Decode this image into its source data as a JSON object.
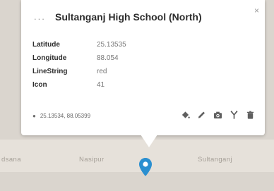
{
  "map": {
    "labels": [
      "dsana",
      "Nasipur",
      "Sultanganj"
    ]
  },
  "popup": {
    "ellipsis": "...",
    "title": "Sultanganj High School (North)",
    "close_label": "×",
    "properties": [
      {
        "key": "Latitude",
        "value": "25.13535"
      },
      {
        "key": "Longitude",
        "value": "88.054"
      },
      {
        "key": "LineString",
        "value": "red"
      },
      {
        "key": "Icon",
        "value": "41"
      }
    ],
    "coordinates": "25.13534, 88.05399"
  },
  "colors": {
    "accent": "#2a8fd0",
    "tool_icon": "#5f5f5f"
  },
  "icons": [
    "close-icon",
    "location-pin-icon",
    "paint-bucket-icon",
    "pencil-icon",
    "camera-icon",
    "routing-icon",
    "trash-icon",
    "map-marker-icon"
  ]
}
